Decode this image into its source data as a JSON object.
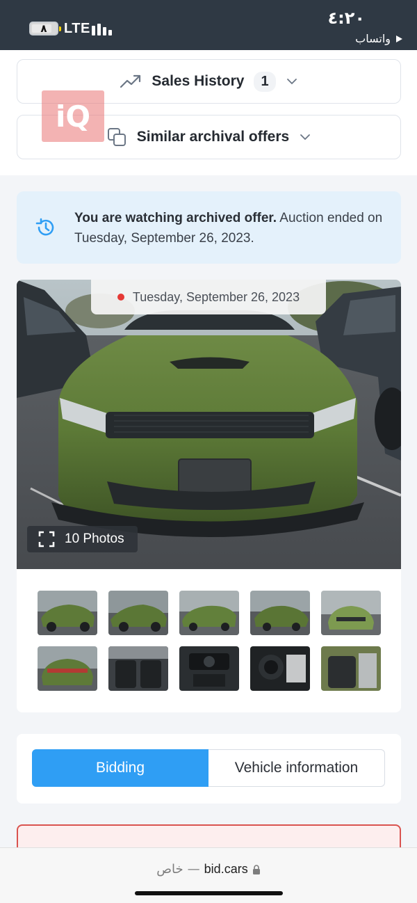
{
  "status_bar": {
    "battery_level": "٨",
    "network": "LTE",
    "time": "٤:٢٠",
    "back_app": "واتساب"
  },
  "sales_history": {
    "label": "Sales History",
    "count": "1"
  },
  "similar_offers": {
    "label": "Similar archival offers"
  },
  "watermark": {
    "text": "iQ"
  },
  "notice": {
    "bold": "You are watching archived offer.",
    "text": " Auction ended on Tuesday, September 26, 2023."
  },
  "gallery": {
    "date": "Tuesday, September 26, 2023",
    "photos_label": "10 Photos",
    "photo_count": 10
  },
  "tabs": [
    {
      "label": "Bidding",
      "active": true
    },
    {
      "label": "Vehicle information",
      "active": false
    }
  ],
  "browser": {
    "domain": "bid.cars",
    "separator": "—",
    "private_label": "خاص"
  },
  "colors": {
    "status_bar_bg": "#2f3944",
    "accent": "#2f9ef4",
    "notice_bg": "#e4f1fb",
    "car_green": "#5f7a3c",
    "live_dot": "#e53935"
  }
}
